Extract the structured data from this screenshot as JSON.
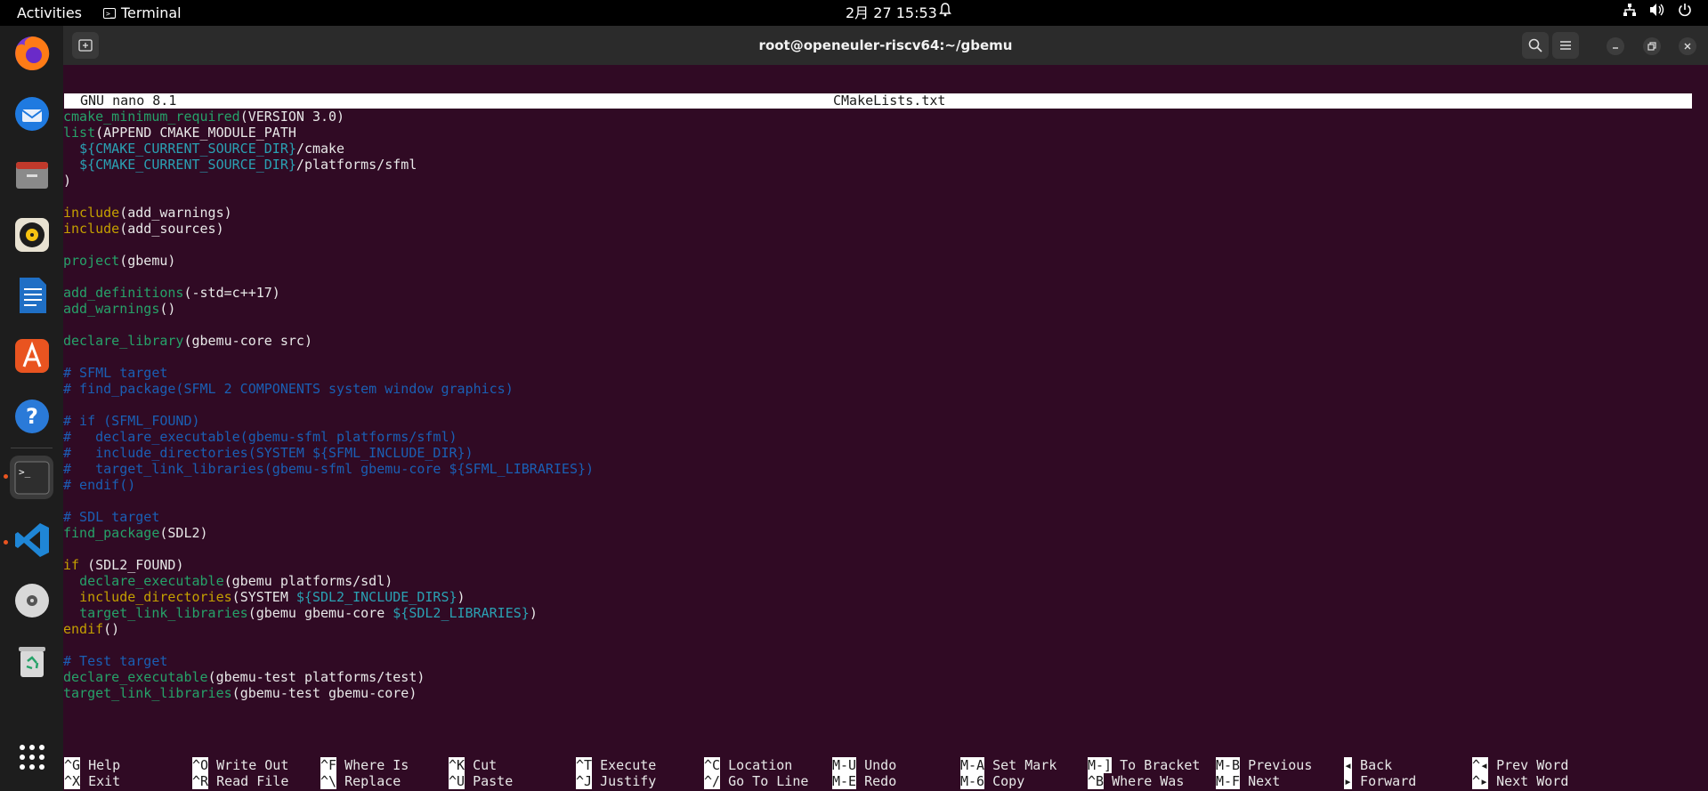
{
  "topbar": {
    "activities": "Activities",
    "app_name": "Terminal",
    "clock": "2月 27  15:53",
    "tray_icons": [
      "network-icon",
      "volume-icon",
      "power-icon"
    ]
  },
  "dock": {
    "apps": [
      "firefox",
      "thunderbird",
      "files",
      "rhythmbox",
      "libreoffice-writer",
      "app-center",
      "help",
      "terminal",
      "vscode",
      "disc",
      "trash",
      "show-apps"
    ]
  },
  "window": {
    "title": "root@openeuler-riscv64:~/gbemu"
  },
  "nano": {
    "version": "GNU nano 8.1",
    "filename": "CMakeLists.txt"
  },
  "code_lines": [
    "cmake_minimum_required(VERSION 3.0)",
    "list(APPEND CMAKE_MODULE_PATH",
    "  ${CMAKE_CURRENT_SOURCE_DIR}/cmake",
    "  ${CMAKE_CURRENT_SOURCE_DIR}/platforms/sfml",
    ")",
    "",
    "include(add_warnings)",
    "include(add_sources)",
    "",
    "project(gbemu)",
    "",
    "add_definitions(-std=c++17)",
    "add_warnings()",
    "",
    "declare_library(gbemu-core src)",
    "",
    "# SFML target",
    "# find_package(SFML 2 COMPONENTS system window graphics)",
    "",
    "# if (SFML_FOUND)",
    "#   declare_executable(gbemu-sfml platforms/sfml)",
    "#   include_directories(SYSTEM ${SFML_INCLUDE_DIR})",
    "#   target_link_libraries(gbemu-sfml gbemu-core ${SFML_LIBRARIES})",
    "# endif()",
    "",
    "# SDL target",
    "find_package(SDL2)",
    "",
    "if (SDL2_FOUND)",
    "  declare_executable(gbemu platforms/sdl)",
    "  include_directories(SYSTEM ${SDL2_INCLUDE_DIRS})",
    "  target_link_libraries(gbemu gbemu-core ${SDL2_LIBRARIES})",
    "endif()",
    "",
    "# Test target",
    "declare_executable(gbemu-test platforms/test)",
    "target_link_libraries(gbemu-test gbemu-core)"
  ],
  "shortcuts": [
    {
      "key": "^G",
      "label": "Help"
    },
    {
      "key": "^X",
      "label": "Exit"
    },
    {
      "key": "^O",
      "label": "Write Out"
    },
    {
      "key": "^R",
      "label": "Read File"
    },
    {
      "key": "^F",
      "label": "Where Is"
    },
    {
      "key": "^\\",
      "label": "Replace"
    },
    {
      "key": "^K",
      "label": "Cut"
    },
    {
      "key": "^U",
      "label": "Paste"
    },
    {
      "key": "^T",
      "label": "Execute"
    },
    {
      "key": "^J",
      "label": "Justify"
    },
    {
      "key": "^C",
      "label": "Location"
    },
    {
      "key": "^/",
      "label": "Go To Line"
    },
    {
      "key": "M-U",
      "label": "Undo"
    },
    {
      "key": "M-E",
      "label": "Redo"
    },
    {
      "key": "M-A",
      "label": "Set Mark"
    },
    {
      "key": "M-6",
      "label": "Copy"
    },
    {
      "key": "M-]",
      "label": "To Bracket"
    },
    {
      "key": "^B",
      "label": "Where Was"
    },
    {
      "key": "M-B",
      "label": "Previous"
    },
    {
      "key": "M-F",
      "label": "Next"
    },
    {
      "key": "◂",
      "label": "Back"
    },
    {
      "key": "▸",
      "label": "Forward"
    },
    {
      "key": "^◂",
      "label": "Prev Word"
    },
    {
      "key": "^▸",
      "label": "Next Word"
    }
  ]
}
